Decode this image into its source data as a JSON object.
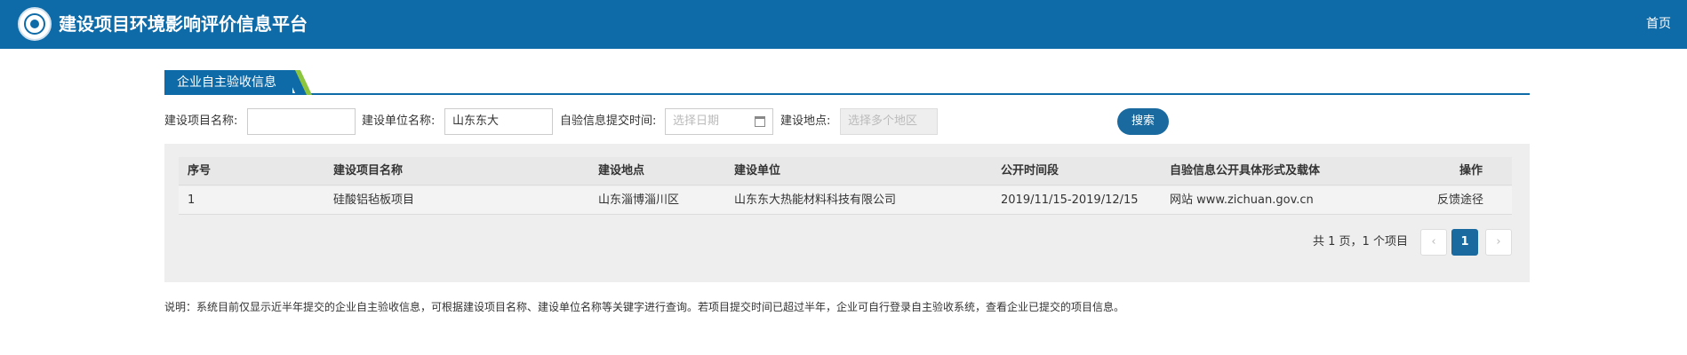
{
  "header": {
    "title": "建设项目环境影响评价信息平台",
    "home_link": "首页"
  },
  "tab": {
    "label": "企业自主验收信息"
  },
  "filters": {
    "project_name_label": "建设项目名称:",
    "project_name_value": "",
    "unit_name_label": "建设单位名称:",
    "unit_name_value": "山东东大",
    "submit_time_label": "自验信息提交时间:",
    "submit_time_placeholder": "选择日期",
    "location_label": "建设地点:",
    "location_placeholder": "选择多个地区",
    "search_button": "搜索"
  },
  "table": {
    "columns": [
      "序号",
      "建设项目名称",
      "建设地点",
      "建设单位",
      "公开时间段",
      "自验信息公开具体形式及载体",
      "操作"
    ],
    "rows": [
      {
        "index": "1",
        "project_name": "硅酸铝毡板项目",
        "location": "山东淄博淄川区",
        "unit": "山东东大热能材料科技有限公司",
        "period": "2019/11/15-2019/12/15",
        "disclosure": "网站 www.zichuan.gov.cn",
        "action": "反馈途径"
      }
    ]
  },
  "pagination": {
    "summary": "共 1 页，1 个项目",
    "prev": "‹",
    "current": "1",
    "next": "›"
  },
  "note": "说明：系统目前仅显示近半年提交的企业自主验收信息，可根据建设项目名称、建设单位名称等关键字进行查询。若项目提交时间已超过半年，企业可自行登录自主验收系统，查看企业已提交的项目信息。",
  "colors": {
    "header_bg": "#0e6ba8",
    "accent_green": "#8cc63f",
    "button_bg": "#1a6aa0",
    "panel_bg": "#eeeeee"
  }
}
